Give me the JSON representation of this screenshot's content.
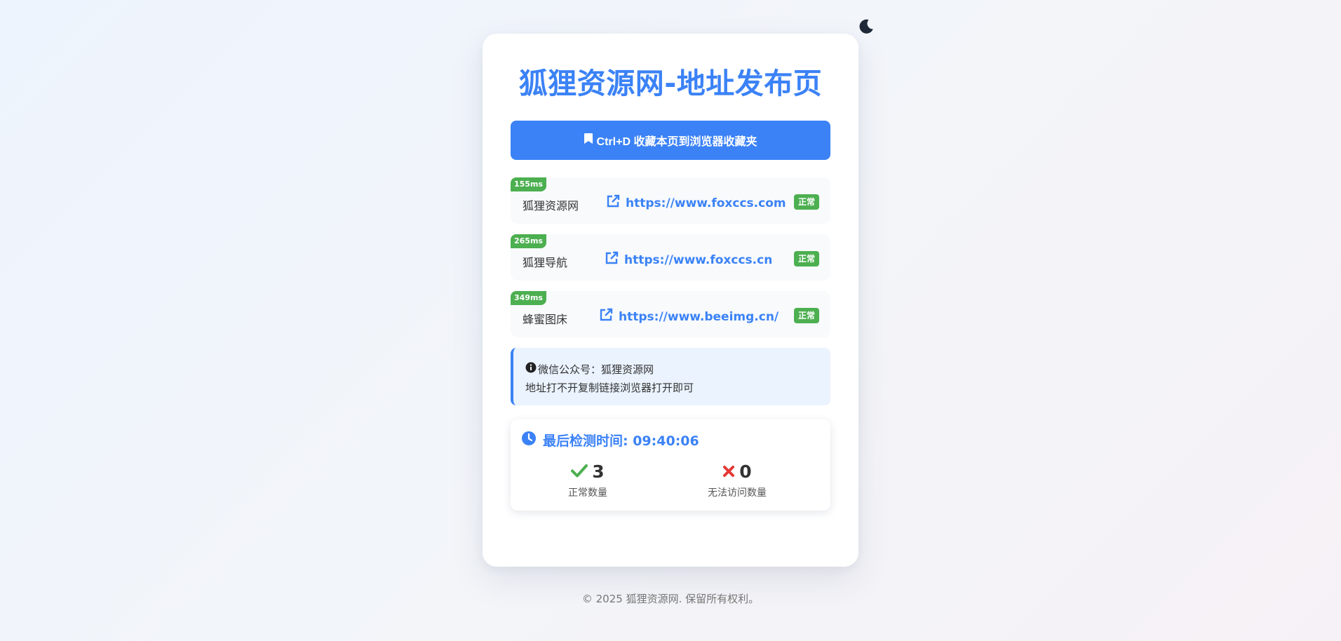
{
  "page": {
    "title": "狐狸资源网-地址发布页",
    "bookmark_label": "Ctrl+D 收藏本页到浏览器收藏夹"
  },
  "links": [
    {
      "latency": "155ms",
      "name": "狐狸资源网",
      "url": "https://www.foxccs.com",
      "status": "正常"
    },
    {
      "latency": "265ms",
      "name": "狐狸导航",
      "url": "https://www.foxccs.cn",
      "status": "正常"
    },
    {
      "latency": "349ms",
      "name": "蜂蜜图床",
      "url": "https://www.beeimg.cn/",
      "status": "正常"
    }
  ],
  "notice": {
    "line1": "微信公众号：狐狸资源网",
    "line2": "地址打不开复制链接浏览器打开即可"
  },
  "stats": {
    "check_time": "最后检测时间: 09:40:06",
    "normal_count": "3",
    "normal_label": "正常数量",
    "failed_count": "0",
    "failed_label": "无法访问数量"
  },
  "footer": "© 2025 狐狸资源网. 保留所有权利。",
  "icons": {
    "theme_toggle": "moon-icon",
    "bookmark": "bookmark-icon",
    "external_link": "external-link-icon",
    "info": "info-icon",
    "clock": "clock-icon",
    "check": "check-icon",
    "cross": "cross-icon"
  },
  "colors": {
    "accent": "#3b82f6",
    "success": "#4caf50",
    "error": "#e53935",
    "notice_bg": "#eaf3fe"
  }
}
